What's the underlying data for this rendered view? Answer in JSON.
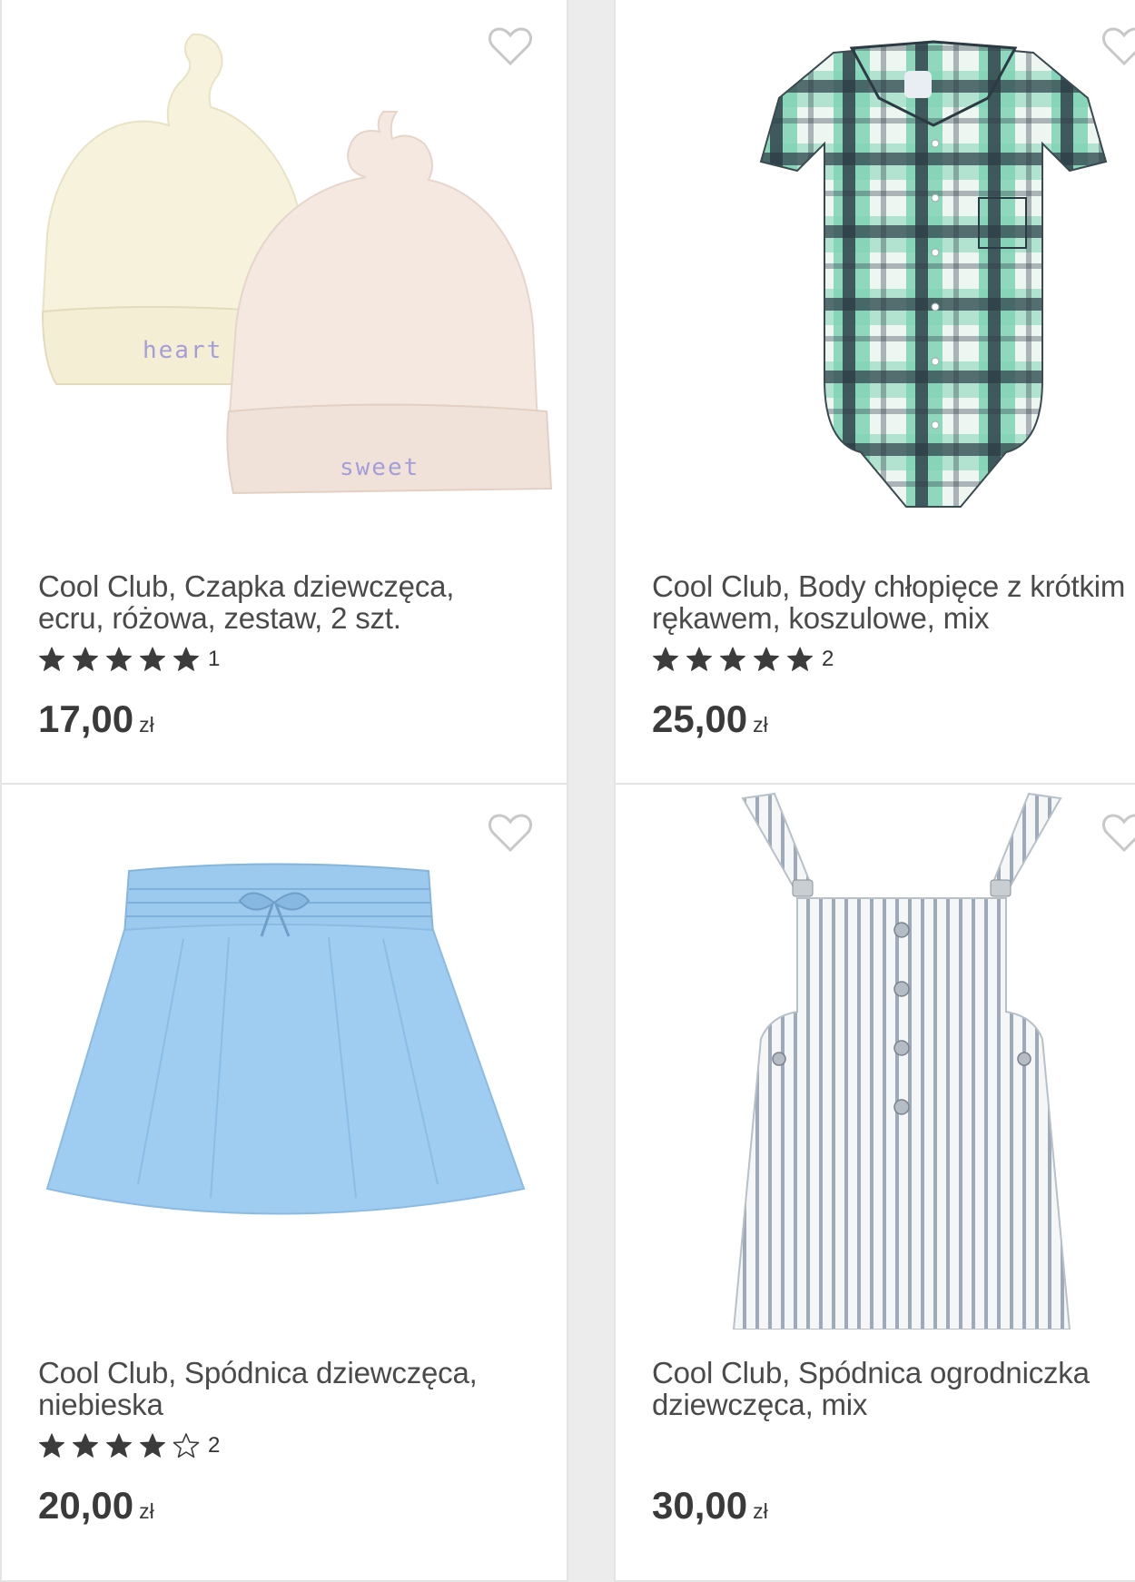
{
  "products": [
    {
      "title": "Cool Club, Czapka dziewczęca,\necru, różowa, zestaw, 2 szt.",
      "rating": 5,
      "rating_count": "1",
      "price": "17,00",
      "currency": "zł",
      "image_text": [
        "heart",
        "sweet"
      ]
    },
    {
      "title": "Cool Club, Body chłopięce z krótkim\nrękawem, koszulowe, mix",
      "rating": 5,
      "rating_count": "2",
      "price": "25,00",
      "currency": "zł"
    },
    {
      "title": "Cool Club, Spódnica dziewczęca,\nniebieska",
      "rating": 4,
      "rating_count": "2",
      "price": "20,00",
      "currency": "zł"
    },
    {
      "title": "Cool Club, Spódnica ogrodniczka\ndziewczęca, mix",
      "rating": 0,
      "rating_count": "",
      "price": "30,00",
      "currency": "zł"
    }
  ],
  "icons": {
    "favorite": "heart-outline-icon",
    "star_full": "star-filled-icon",
    "star_empty": "star-outline-icon"
  },
  "colors": {
    "star": "#3c3c3c",
    "heart_outline": "#c8c8c8",
    "price": "#3a3a3a"
  }
}
